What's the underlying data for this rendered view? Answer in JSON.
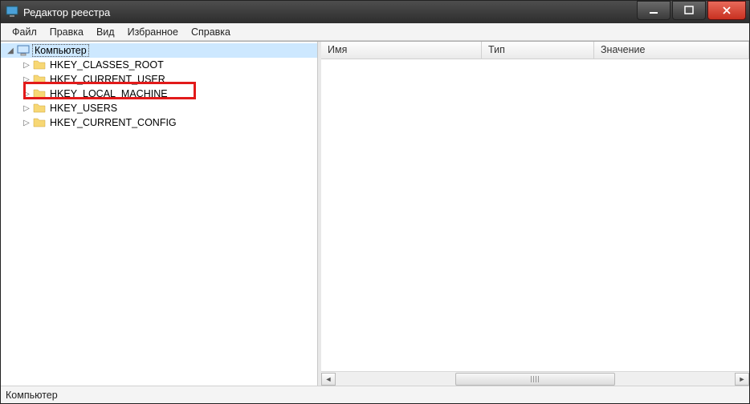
{
  "window": {
    "title": "Редактор реестра"
  },
  "menubar": {
    "items": [
      "Файл",
      "Правка",
      "Вид",
      "Избранное",
      "Справка"
    ]
  },
  "tree": {
    "root": {
      "label": "Компьютер",
      "expanded": true
    },
    "keys": [
      {
        "label": "HKEY_CLASSES_ROOT"
      },
      {
        "label": "HKEY_CURRENT_USER"
      },
      {
        "label": "HKEY_LOCAL_MACHINE",
        "highlighted": true
      },
      {
        "label": "HKEY_USERS"
      },
      {
        "label": "HKEY_CURRENT_CONFIG"
      }
    ]
  },
  "list": {
    "columns": {
      "name": "Имя",
      "type": "Тип",
      "value": "Значение"
    }
  },
  "statusbar": {
    "path": "Компьютер"
  }
}
